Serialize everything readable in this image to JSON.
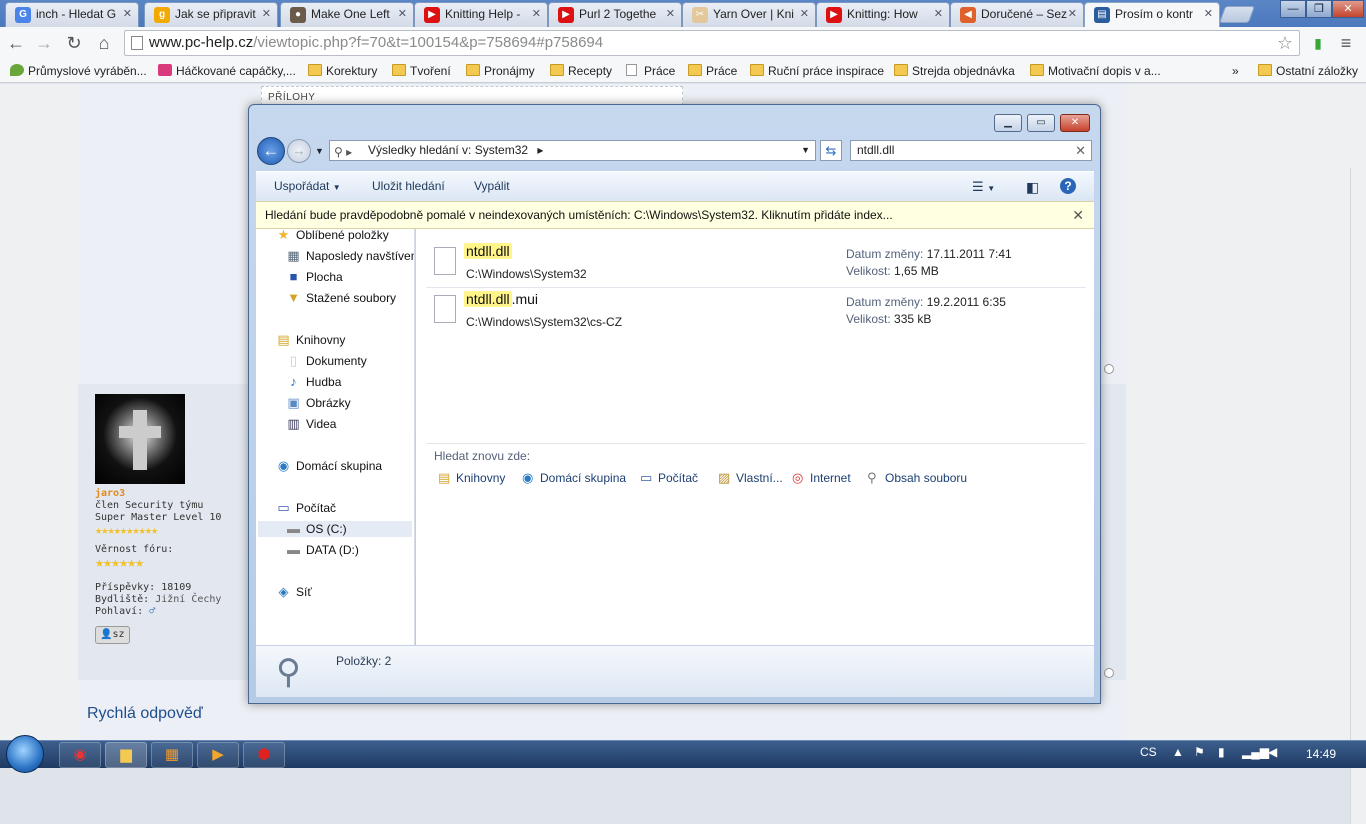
{
  "browser": {
    "tabs": [
      {
        "title": "inch - Hledat G",
        "fav": "G",
        "color": "#4a84e8"
      },
      {
        "title": "Jak se připravit",
        "fav": "g",
        "color": "#f2a900"
      },
      {
        "title": "Make One Left",
        "fav": "●",
        "color": "#6b5b4a"
      },
      {
        "title": "Knitting Help -",
        "fav": "▶",
        "color": "#d11"
      },
      {
        "title": "Purl 2 Togethe",
        "fav": "▶",
        "color": "#d11"
      },
      {
        "title": "Yarn Over | Kni",
        "fav": "✂",
        "color": "#e2c89a"
      },
      {
        "title": "Knitting: How",
        "fav": "▶",
        "color": "#d11"
      },
      {
        "title": "Doručené – Sez",
        "fav": "◀",
        "color": "#e0602b"
      },
      {
        "title": "Prosím o kontr",
        "fav": "▤",
        "color": "#2b5c9e"
      }
    ],
    "url_host": "www.pc-help.cz",
    "url_rest": "/viewtopic.php?f=70&t=100154&p=758694#p758694",
    "bookmarks": [
      {
        "label": "Průmyslové vyráběn...",
        "type": "leaf"
      },
      {
        "label": "Háčkované capáčky,...",
        "type": "f"
      },
      {
        "label": "Korektury",
        "type": "folder"
      },
      {
        "label": "Tvoření",
        "type": "folder"
      },
      {
        "label": "Pronájmy",
        "type": "folder"
      },
      {
        "label": "Recepty",
        "type": "folder"
      },
      {
        "label": "Práce",
        "type": "page"
      },
      {
        "label": "Práce",
        "type": "folder"
      },
      {
        "label": "Ruční práce inspirace",
        "type": "folder"
      },
      {
        "label": "Strejda objednávka",
        "type": "folder"
      },
      {
        "label": "Motivační dopis v a...",
        "type": "folder"
      }
    ],
    "overflow": "»",
    "other_bookmarks": "Ostatní záložky"
  },
  "forum": {
    "attachments_label": "PŘÍLOHY",
    "profile": {
      "name": "jaro3",
      "role": "člen Security týmu",
      "level": "Super Master Level 10",
      "rank_stars": "★★★★★★★★★★",
      "loyalty_label": "Věrnost fóru:",
      "loyalty_stars": "★★★★★★",
      "posts": "Příspěvky: 18109",
      "location_label": "Bydliště:",
      "location_value": "Jižní Čechy",
      "gender": "Pohlaví:",
      "button": "sz"
    },
    "quick_reply": "Rychlá odpověď"
  },
  "explorer": {
    "address": "Výsledky hledání v: System32",
    "search": "ntdll.dll",
    "commands": {
      "organize": "Uspořádat",
      "save": "Uložit hledání",
      "burn": "Vypálit"
    },
    "infobar": "Hledání bude pravděpodobně pomalé v neindexovaných umístěních: C:\\Windows\\System32. Kliknutím přidáte index...",
    "nav": [
      {
        "label": "Oblíbené položky",
        "icon": "★",
        "indent": 0
      },
      {
        "label": "Naposledy navštívené",
        "icon": "▦",
        "indent": 1
      },
      {
        "label": "Plocha",
        "icon": "■",
        "indent": 1
      },
      {
        "label": "Stažené soubory",
        "icon": "▼",
        "indent": 1
      },
      {
        "label": "Knihovny",
        "icon": "▤",
        "indent": 0
      },
      {
        "label": "Dokumenty",
        "icon": "▯",
        "indent": 1
      },
      {
        "label": "Hudba",
        "icon": "♪",
        "indent": 1
      },
      {
        "label": "Obrázky",
        "icon": "▣",
        "indent": 1
      },
      {
        "label": "Videa",
        "icon": "▥",
        "indent": 1
      },
      {
        "label": "Domácí skupina",
        "icon": "◉",
        "indent": 0
      },
      {
        "label": "Počítač",
        "icon": "▭",
        "indent": 0
      },
      {
        "label": "OS (C:)",
        "icon": "▬",
        "indent": 1
      },
      {
        "label": "DATA (D:)",
        "icon": "▬",
        "indent": 1
      },
      {
        "label": "Síť",
        "icon": "◈",
        "indent": 0
      }
    ],
    "results": [
      {
        "name_hl": "ntdll.dll",
        "name_rest": "",
        "path": "C:\\Windows\\System32",
        "date_label": "Datum změny:",
        "date": "17.11.2011 7:41",
        "size_label": "Velikost:",
        "size": "1,65 MB"
      },
      {
        "name_hl": "ntdll.dll",
        "name_rest": ".mui",
        "path": "C:\\Windows\\System32\\cs-CZ",
        "date_label": "Datum změny:",
        "date": "19.2.2011 6:35",
        "size_label": "Velikost:",
        "size": "335 kB"
      }
    ],
    "search_again": "Hledat znovu zde:",
    "search_again_items": [
      "Knihovny",
      "Domácí skupina",
      "Počítač",
      "Vlastní...",
      "Internet",
      "Obsah souboru"
    ],
    "items_count": "Položky: 2"
  },
  "taskbar": {
    "lang": "CS",
    "time": "14:49"
  }
}
